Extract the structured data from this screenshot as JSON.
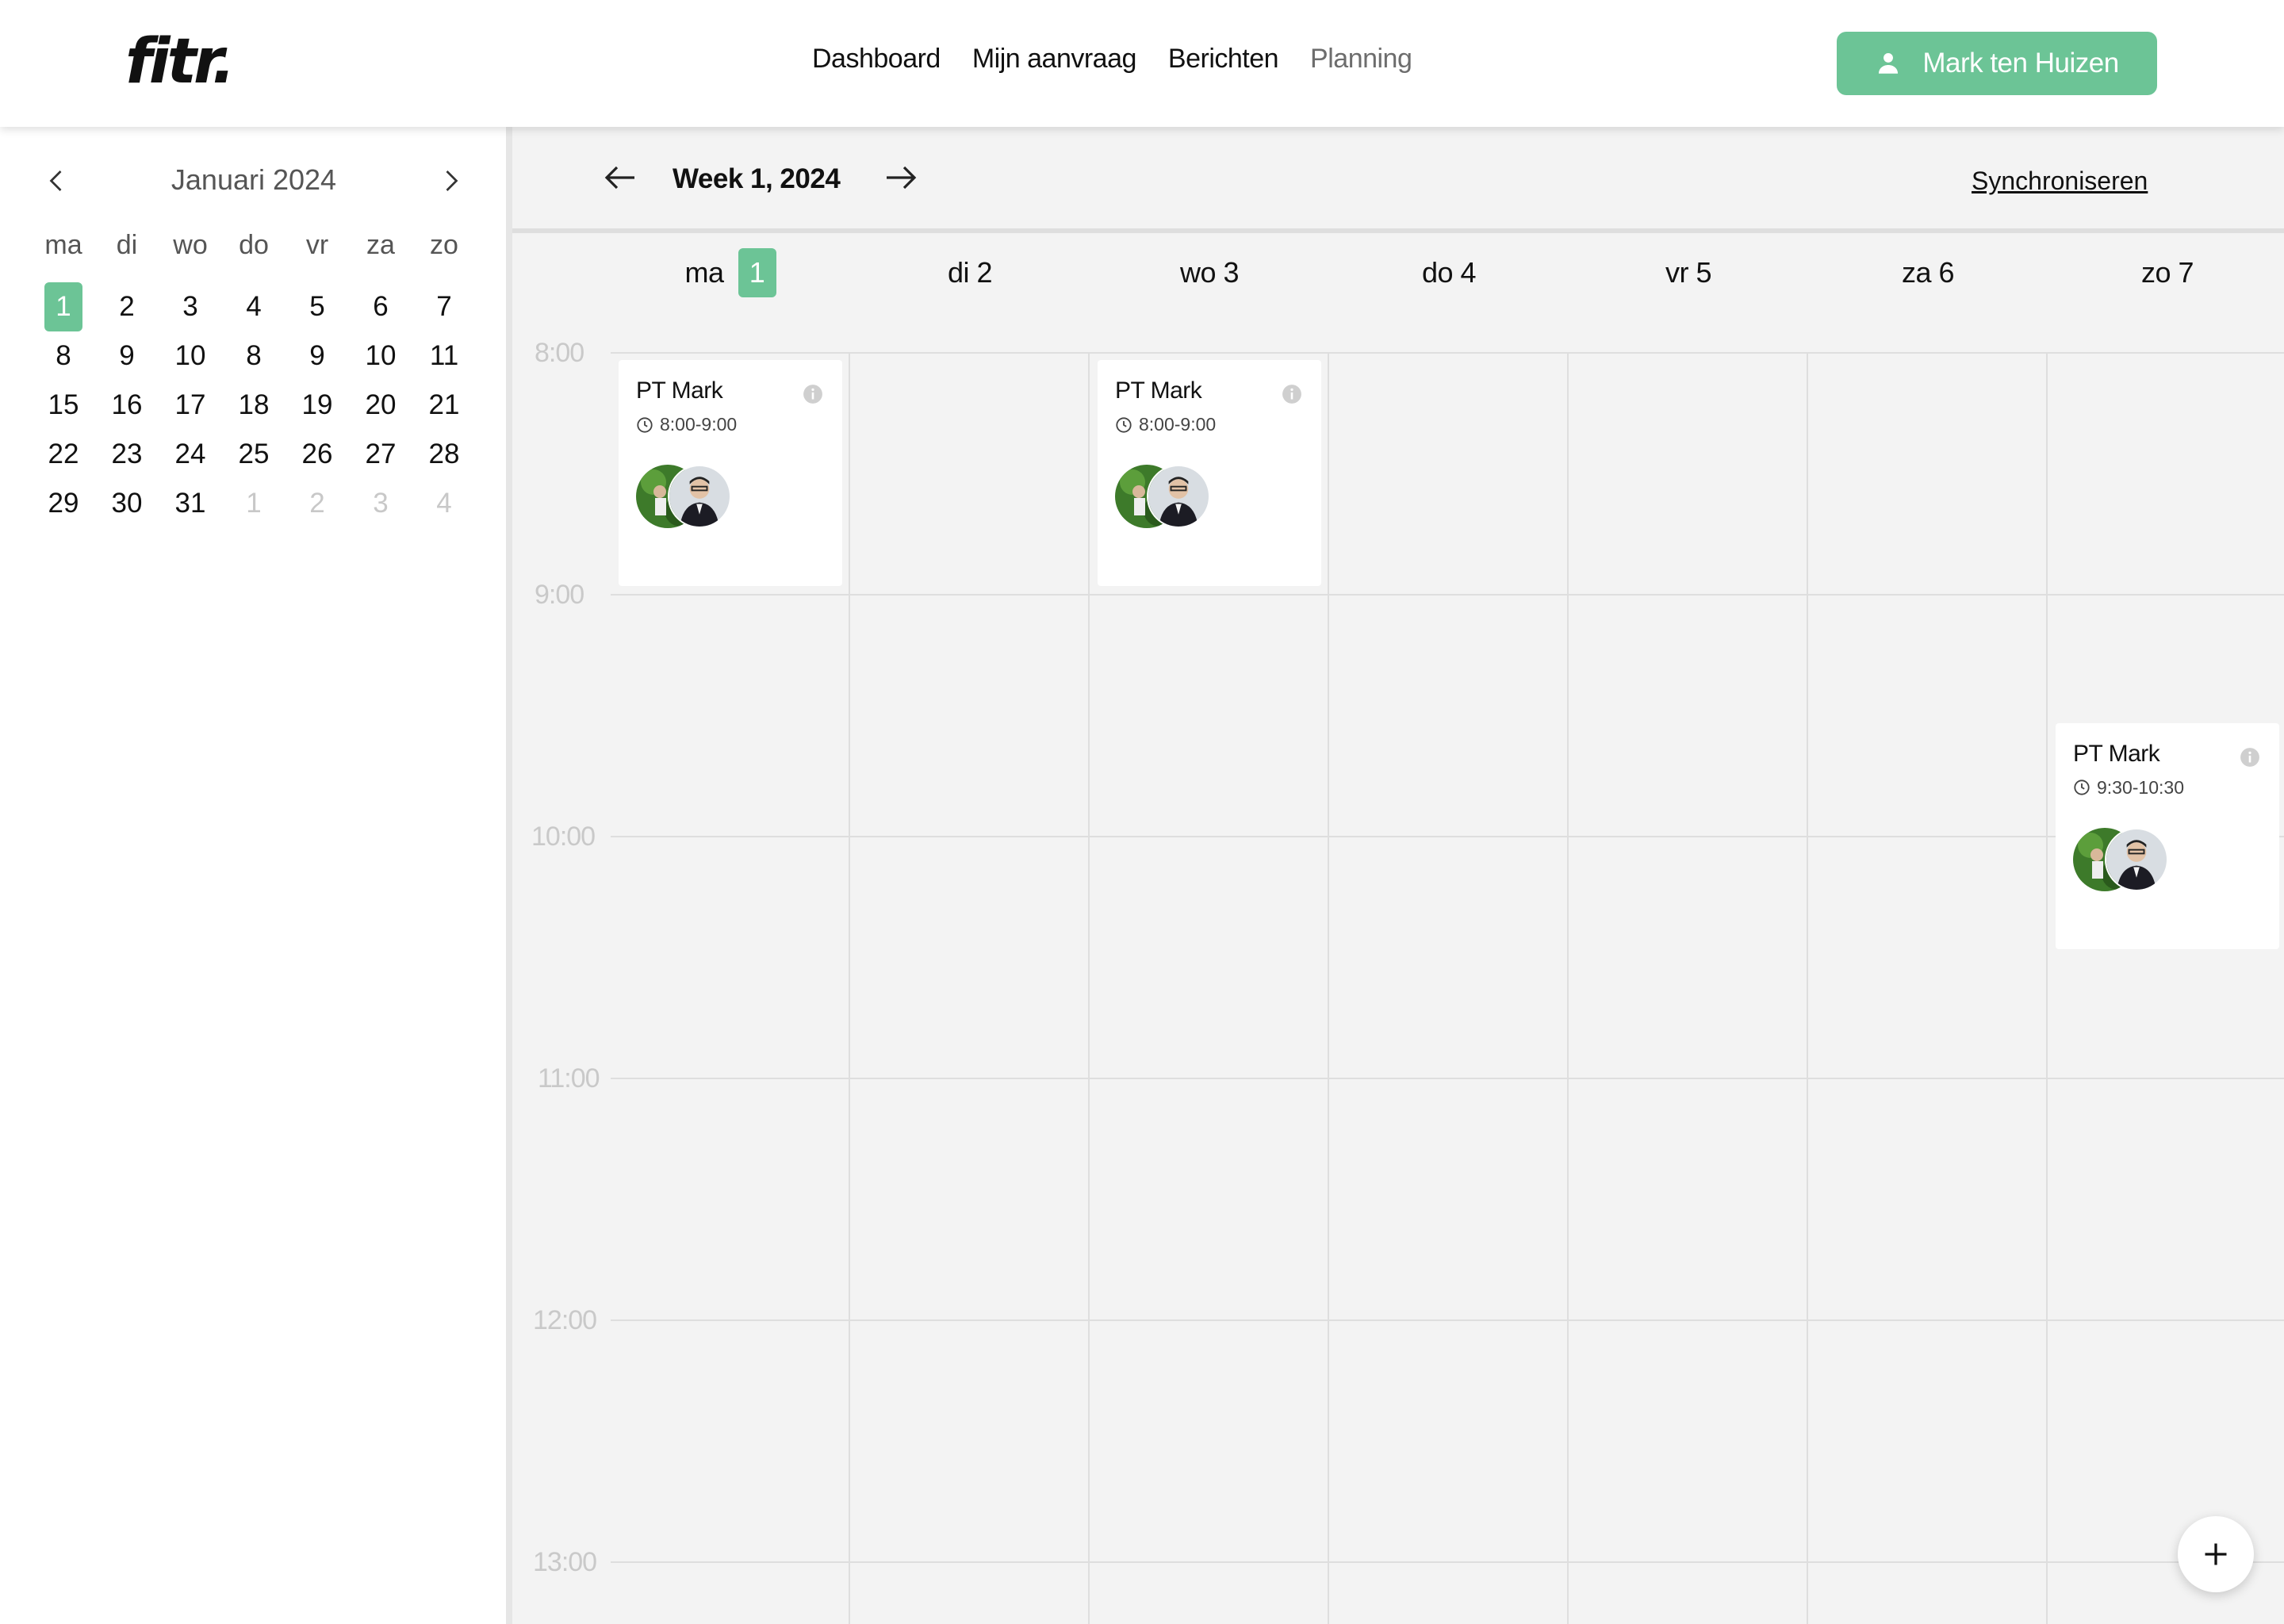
{
  "brand": {
    "logo_text": "fitr."
  },
  "nav": {
    "items": [
      {
        "label": "Dashboard"
      },
      {
        "label": "Mijn aanvraag"
      },
      {
        "label": "Berichten"
      },
      {
        "label": "Planning"
      }
    ]
  },
  "user": {
    "name": "Mark ten Huizen",
    "icon": "person-icon"
  },
  "mini_calendar": {
    "title": "Januari 2024",
    "weekdays": [
      "ma",
      "di",
      "wo",
      "do",
      "vr",
      "za",
      "zo"
    ],
    "days": [
      "1",
      "2",
      "3",
      "4",
      "5",
      "6",
      "7",
      "8",
      "9",
      "10",
      "8",
      "9",
      "10",
      "11",
      "15",
      "16",
      "17",
      "18",
      "19",
      "20",
      "21",
      "22",
      "23",
      "24",
      "25",
      "26",
      "27",
      "28",
      "29",
      "30",
      "31",
      "1",
      "2",
      "3",
      "4"
    ],
    "selected_day": "1",
    "muted_trailing_days": [
      "1",
      "2",
      "3",
      "4"
    ]
  },
  "week": {
    "title": "Week 1, 2024",
    "sync_label": "Synchroniseren",
    "days": [
      {
        "name": "ma",
        "num": "1",
        "highlight": true
      },
      {
        "name": "di 2"
      },
      {
        "name": "wo 3"
      },
      {
        "name": "do 4"
      },
      {
        "name": "vr 5"
      },
      {
        "name": "za 6"
      },
      {
        "name": "zo 7"
      }
    ],
    "hours": [
      "8:00",
      "9:00",
      "10:00",
      "11:00",
      "12:00",
      "13:00"
    ]
  },
  "events": [
    {
      "title": "PT Mark",
      "time": "8:00-9:00",
      "day_index": 0,
      "start_hour": 8.0,
      "end_hour": 9.0
    },
    {
      "title": "PT Mark",
      "time": "8:00-9:00",
      "day_index": 2,
      "start_hour": 8.0,
      "end_hour": 9.0
    },
    {
      "title": "PT Mark",
      "time": "9:30-10:30",
      "day_index": 6,
      "start_hour": 9.5,
      "end_hour": 10.5
    }
  ],
  "colors": {
    "accent": "#6cc496",
    "grid_bg": "#f3f3f3",
    "grid_line": "#dedede"
  }
}
